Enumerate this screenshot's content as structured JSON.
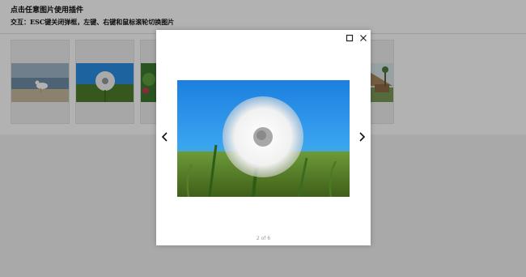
{
  "header": {
    "title": "点击任意图片使用插件",
    "instructions": "交互：ESC键关闭弹框，左键、右键和鼠标滚轮切换图片"
  },
  "gallery": {
    "thumbnails": [
      {
        "subject": "seagull-on-beach"
      },
      {
        "subject": "dandelion"
      },
      {
        "subject": "green-plant"
      },
      {
        "subject": "hidden"
      },
      {
        "subject": "hidden"
      },
      {
        "subject": "thatched-hut"
      }
    ]
  },
  "lightbox": {
    "counter_text": "2 of 6",
    "current_index": 2,
    "total": 6,
    "icons": {
      "maximize": "maximize-icon",
      "close": "close-icon",
      "prev": "chevron-left-icon",
      "next": "chevron-right-icon"
    }
  },
  "colors": {
    "overlay": "rgba(0,0,0,0.30)",
    "sky": "#1e8be6",
    "grass": "#5a8a2a"
  }
}
